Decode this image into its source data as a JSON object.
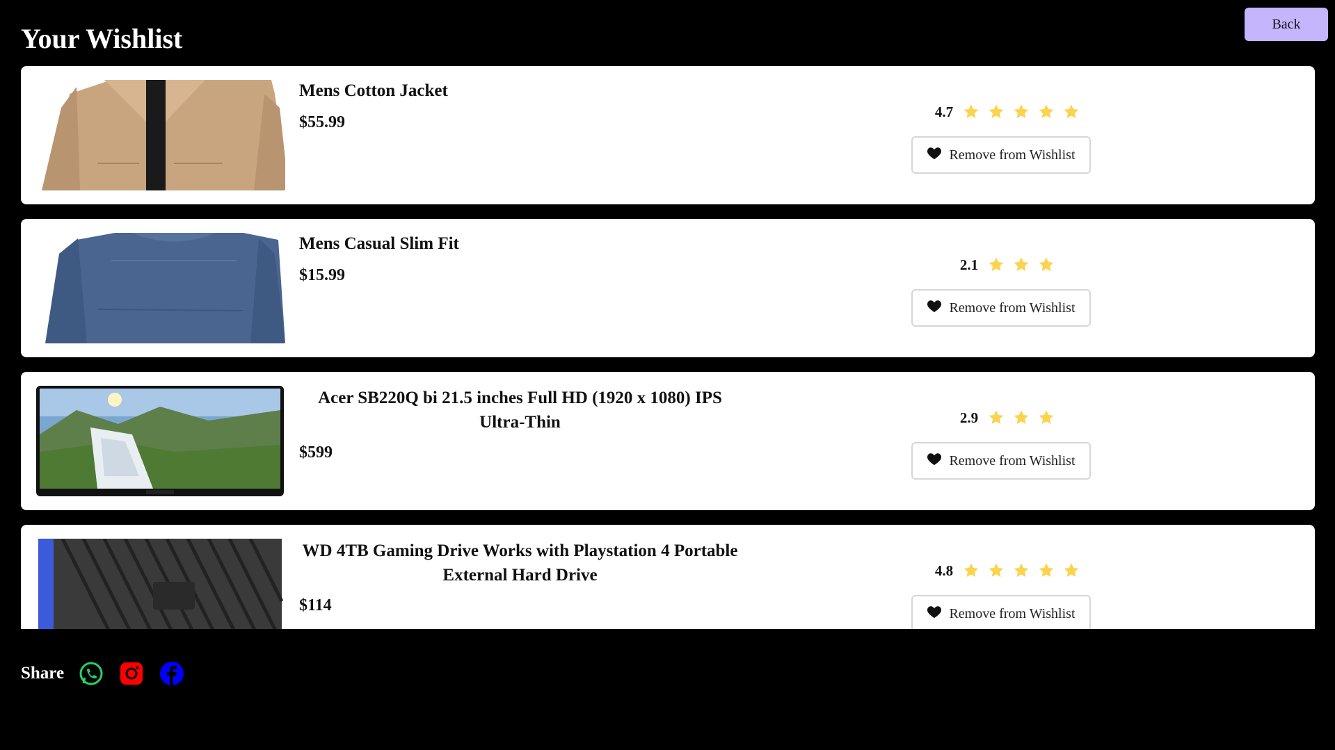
{
  "header": {
    "title": "Your Wishlist",
    "back_label": "Back"
  },
  "colors": {
    "accent": "#c4b5fd",
    "star": "#fcd34d",
    "whatsapp": "#25d366",
    "instagram": "#ff0000",
    "facebook": "#0000ff"
  },
  "items": [
    {
      "title": "Mens Cotton Jacket",
      "price": "$55.99",
      "rating": "4.7",
      "stars": 5,
      "remove_label": "Remove from Wishlist",
      "image": "jacket-photo"
    },
    {
      "title": "Mens Casual Slim Fit",
      "price": "$15.99",
      "rating": "2.1",
      "stars": 3,
      "remove_label": "Remove from Wishlist",
      "image": "shirt-photo"
    },
    {
      "title": "Acer SB220Q bi 21.5 inches Full HD (1920 x 1080) IPS Ultra-Thin",
      "price": "$599",
      "rating": "2.9",
      "stars": 3,
      "remove_label": "Remove from Wishlist",
      "image": "monitor-photo"
    },
    {
      "title": "WD 4TB Gaming Drive Works with Playstation 4 Portable External Hard Drive",
      "price": "$114",
      "rating": "4.8",
      "stars": 5,
      "remove_label": "Remove from Wishlist",
      "image": "hard-drive-photo"
    }
  ],
  "share": {
    "label": "Share",
    "icons": [
      "whatsapp-icon",
      "instagram-icon",
      "facebook-icon"
    ]
  }
}
